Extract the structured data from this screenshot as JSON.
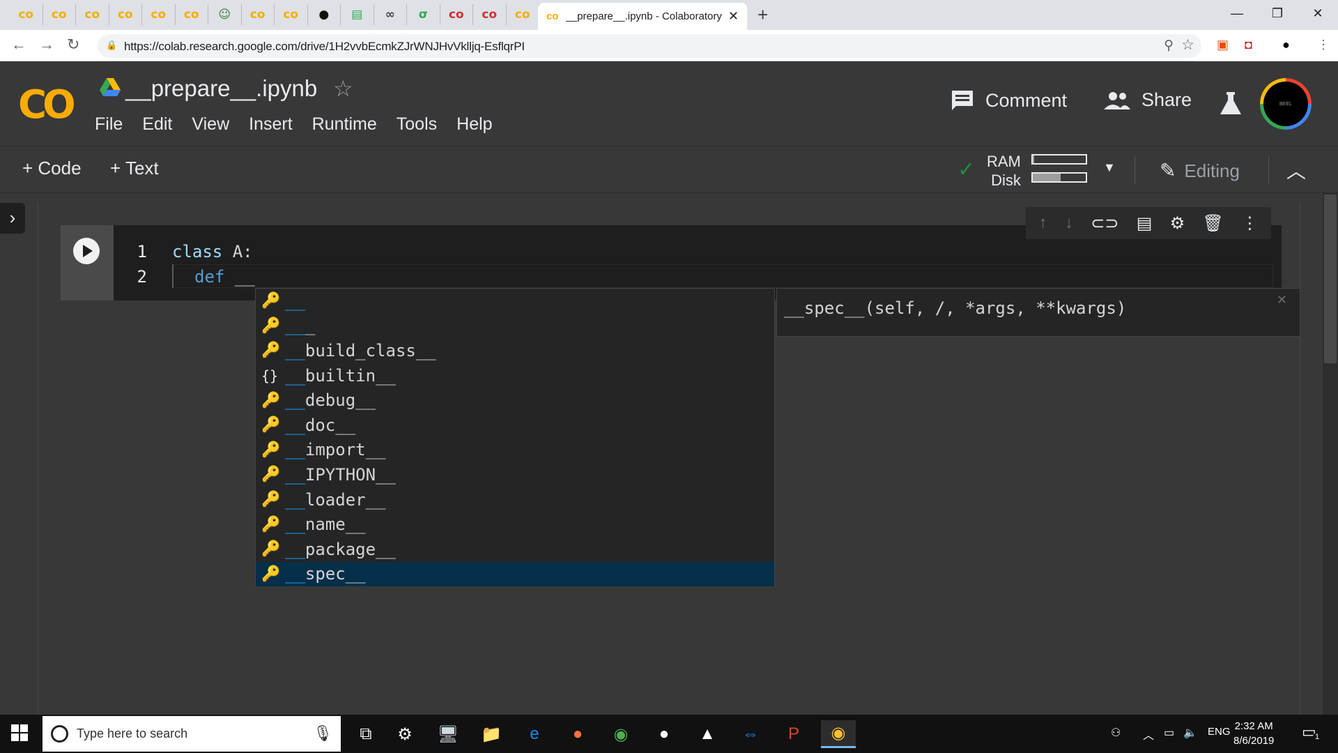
{
  "browser": {
    "pinned_tabs": [
      {
        "icon": "colab-icon",
        "glyph": "co",
        "color": "#f9ab00"
      },
      {
        "icon": "colab-icon",
        "glyph": "co",
        "color": "#f9ab00"
      },
      {
        "icon": "colab-icon",
        "glyph": "co",
        "color": "#f9ab00"
      },
      {
        "icon": "colab-icon",
        "glyph": "co",
        "color": "#f9ab00"
      },
      {
        "icon": "colab-icon",
        "glyph": "co",
        "color": "#f9ab00"
      },
      {
        "icon": "colab-icon",
        "glyph": "co",
        "color": "#f9ab00"
      },
      {
        "icon": "smiley-icon",
        "glyph": "☺",
        "color": "#2e7d32"
      },
      {
        "icon": "colab-icon",
        "glyph": "co",
        "color": "#f9ab00"
      },
      {
        "icon": "colab-icon",
        "glyph": "co",
        "color": "#f9ab00"
      },
      {
        "icon": "github-icon",
        "glyph": "●",
        "color": "#111111"
      },
      {
        "icon": "doc-icon",
        "glyph": "▤",
        "color": "#34a853"
      },
      {
        "icon": "infinity-icon",
        "glyph": "∞",
        "color": "#444444"
      },
      {
        "icon": "leaf-icon",
        "glyph": "σ",
        "color": "#34a853"
      },
      {
        "icon": "colab-red-icon",
        "glyph": "co",
        "color": "#d32f2f"
      },
      {
        "icon": "colab-red-icon",
        "glyph": "co",
        "color": "#d32f2f"
      },
      {
        "icon": "colab-icon",
        "glyph": "co",
        "color": "#f9ab00"
      }
    ],
    "active_tab": {
      "favicon": "co",
      "title": "__prepare__.ipynb - Colaboratory",
      "close": "✕"
    },
    "new_tab": "+",
    "window_controls": {
      "minimize": "—",
      "maximize": "❐",
      "close": "✕"
    },
    "nav": {
      "back": "←",
      "forward": "→",
      "reload": "↻"
    },
    "url": "https://colab.research.google.com/drive/1H2vvbEcmkZJrWNJHvVklljq-EsflqrPI"
  },
  "colab": {
    "logo": "CO",
    "notebook_title": "__prepare__.ipynb",
    "title_star": "☆",
    "menu": [
      "File",
      "Edit",
      "View",
      "Insert",
      "Runtime",
      "Tools",
      "Help"
    ],
    "comment_label": "Comment",
    "share_label": "Share",
    "avatar_text": "BEEL"
  },
  "toolbar": {
    "add_code": "+ Code",
    "add_text": "+ Text",
    "check": "✓",
    "ram_label": "RAM",
    "disk_label": "Disk",
    "ram_usage": 0.03,
    "disk_usage": 0.52,
    "dropdown": "▼",
    "editing_label": "Editing",
    "collapse": "︿"
  },
  "cell": {
    "line_numbers": [
      "1",
      "2"
    ],
    "line1": {
      "keyword": "class",
      "rest": " A:"
    },
    "line2": {
      "keyword": "def",
      "rest": " __"
    },
    "toolbar_icons": [
      "arrow-up-icon",
      "arrow-down-icon",
      "link-icon",
      "comment-icon",
      "gear-icon",
      "trash-icon",
      "more-vert-icon"
    ]
  },
  "autocomplete": {
    "items": [
      {
        "icon": "key",
        "match": "__",
        "rest": ""
      },
      {
        "icon": "key",
        "match": "__",
        "rest": "_"
      },
      {
        "icon": "key",
        "match": "__",
        "rest": "build_class__"
      },
      {
        "icon": "braces",
        "match": "__",
        "rest": "builtin__"
      },
      {
        "icon": "key",
        "match": "__",
        "rest": "debug__"
      },
      {
        "icon": "key",
        "match": "__",
        "rest": "doc__"
      },
      {
        "icon": "key",
        "match": "__",
        "rest": "import__"
      },
      {
        "icon": "key",
        "match": "__",
        "rest": "IPYTHON__"
      },
      {
        "icon": "key",
        "match": "__",
        "rest": "loader__"
      },
      {
        "icon": "key",
        "match": "__",
        "rest": "name__"
      },
      {
        "icon": "key",
        "match": "__",
        "rest": "package__"
      },
      {
        "icon": "key",
        "match": "__",
        "rest": "spec__"
      }
    ],
    "selected_index": 11,
    "detail_signature": "__spec__(self, /, *args, **kwargs)",
    "detail_close": "✕"
  },
  "taskbar": {
    "search_placeholder": "Type here to search",
    "apps": [
      {
        "name": "task-view-icon",
        "glyph": "⧉",
        "color": "#ffffff"
      },
      {
        "name": "settings-icon",
        "glyph": "⚙",
        "color": "#ffffff"
      },
      {
        "name": "computer-icon",
        "glyph": "🖥",
        "color": "#cfd8dc"
      },
      {
        "name": "file-explorer-icon",
        "glyph": "📁",
        "color": "#f9c74f"
      },
      {
        "name": "edge-icon",
        "glyph": "e",
        "color": "#1e88e5"
      },
      {
        "name": "firefox-icon",
        "glyph": "●",
        "color": "#ff7043"
      },
      {
        "name": "chrome-icon",
        "glyph": "◉",
        "color": "#4caf50"
      },
      {
        "name": "github-desktop-icon",
        "glyph": "●",
        "color": "#ffffff"
      },
      {
        "name": "photos-icon",
        "glyph": "▲",
        "color": "#ffffff"
      },
      {
        "name": "teamviewer-icon",
        "glyph": "⇔",
        "color": "#1e88e5"
      },
      {
        "name": "powerpoint-icon",
        "glyph": "P",
        "color": "#d24726"
      },
      {
        "name": "chrome-active-icon",
        "glyph": "◉",
        "color": "#fbc02d"
      }
    ],
    "tray_lang": "ENG",
    "time": "2:32 AM",
    "date": "8/6/2019",
    "notification_count": "1"
  }
}
